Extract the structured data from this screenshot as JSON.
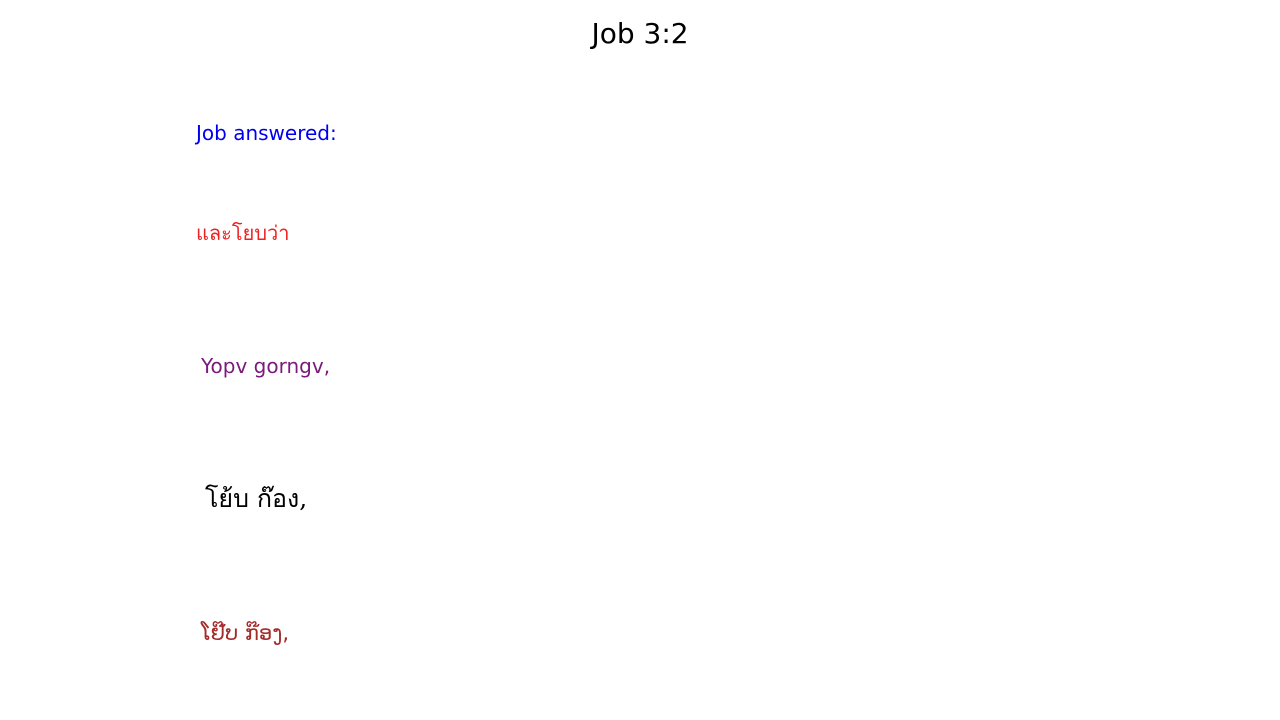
{
  "title": "Job 3:2",
  "lines": {
    "english": {
      "text": "Job answered:",
      "color": "#0000ee"
    },
    "thai": {
      "text": "และโยบว่า",
      "color": "#ee2222"
    },
    "romanized": {
      "text": "Yopv gorngv,",
      "color": "#7a1a7a"
    },
    "thai_script": {
      "text": "โย้บ ก๊อง,",
      "color": "#000000"
    },
    "lao_script": {
      "text": "ໂຢ໊ບ ກ໊ອງ,",
      "color": "#a52a2a"
    }
  }
}
